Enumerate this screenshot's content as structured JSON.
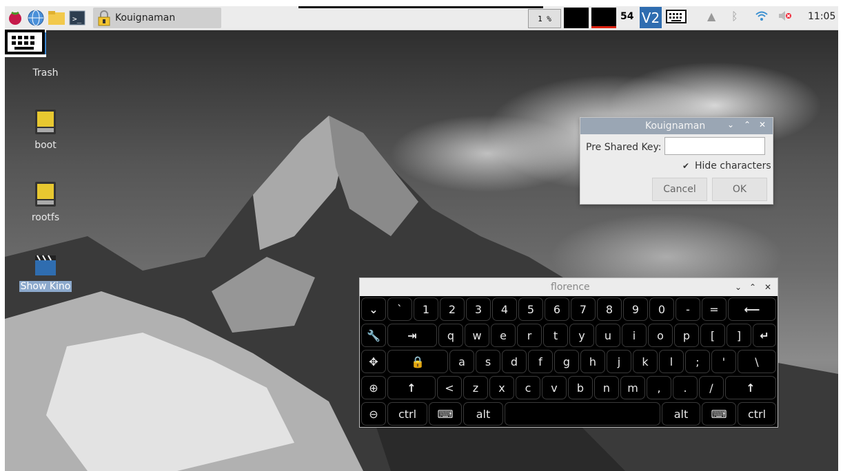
{
  "taskbar": {
    "task_title": "Kouignaman",
    "cpu": "1 %",
    "temp": "54",
    "vnc": "V2",
    "clock": "11:05",
    "icons": [
      "raspberry-menu-icon",
      "web-browser-icon",
      "file-manager-icon",
      "terminal-icon",
      "lock-icon",
      "keyboard-icon",
      "eject-icon",
      "bluetooth-icon",
      "wifi-icon",
      "volume-muted-icon"
    ]
  },
  "desktop": {
    "icons": [
      {
        "name": "trash",
        "label": "Trash"
      },
      {
        "name": "boot",
        "label": "boot"
      },
      {
        "name": "rootfs",
        "label": "rootfs"
      },
      {
        "name": "show-kino",
        "label": "Show Kino"
      }
    ]
  },
  "dialog": {
    "title": "Kouignaman",
    "psk_label": "Pre Shared Key:",
    "psk_value": "",
    "hide_label": "Hide characters",
    "hide_checked": true,
    "cancel": "Cancel",
    "ok": "OK"
  },
  "florence": {
    "title": "florence",
    "rows": [
      [
        "⌄",
        "`",
        "1",
        "2",
        "3",
        "4",
        "5",
        "6",
        "7",
        "8",
        "9",
        "0",
        "-",
        "=",
        "⟵"
      ],
      [
        "🔧",
        "⇥",
        "q",
        "w",
        "e",
        "r",
        "t",
        "y",
        "u",
        "i",
        "o",
        "p",
        "[",
        "]",
        "↵"
      ],
      [
        "✥",
        "🔒",
        "a",
        "s",
        "d",
        "f",
        "g",
        "h",
        "j",
        "k",
        "l",
        ";",
        "'",
        "\\"
      ],
      [
        "⊕",
        "↑",
        "<",
        "z",
        "x",
        "c",
        "v",
        "b",
        "n",
        "m",
        ",",
        ".",
        "/",
        "↑"
      ],
      [
        "⊖",
        "ctrl",
        "⌨",
        "alt",
        "",
        "alt",
        "⌨",
        "ctrl"
      ]
    ]
  },
  "colors": {
    "accent": "#2f6db0",
    "dialog_title": "#9aa6b4",
    "keyboard_bg": "#000000"
  }
}
